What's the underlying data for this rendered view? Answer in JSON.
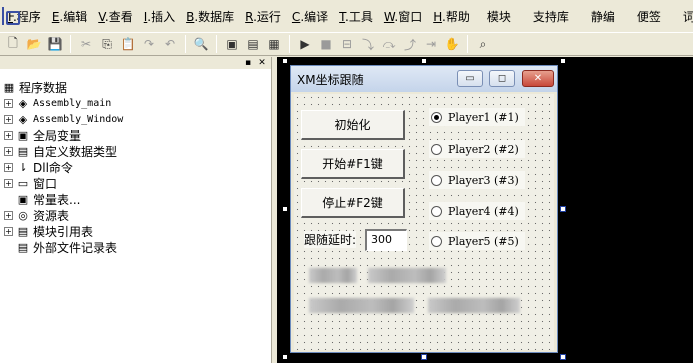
{
  "menubar": {
    "items": [
      {
        "key": "F",
        "label": ".程序"
      },
      {
        "key": "E",
        "label": ".编辑"
      },
      {
        "key": "V",
        "label": ".查看"
      },
      {
        "key": "I",
        "label": ".插入"
      },
      {
        "key": "B",
        "label": ".数据库"
      },
      {
        "key": "R",
        "label": ".运行"
      },
      {
        "key": "C",
        "label": ".编译"
      },
      {
        "key": "T",
        "label": ".工具"
      },
      {
        "key": "W",
        "label": ".窗口"
      },
      {
        "key": "H",
        "label": ".帮助"
      }
    ],
    "extra": [
      "模块",
      "支持库",
      "静编",
      "便签",
      "词表"
    ]
  },
  "tree": {
    "root": "程序数据",
    "items": [
      {
        "label": "Assembly_main",
        "mono": true,
        "expand": "+"
      },
      {
        "label": "Assembly_Window",
        "mono": true,
        "expand": "+"
      },
      {
        "label": "全局变量",
        "expand": "+"
      },
      {
        "label": "自定义数据类型",
        "expand": "+"
      },
      {
        "label": "Dll命令",
        "expand": "+"
      },
      {
        "label": "窗口",
        "expand": "+"
      },
      {
        "label": "常量表...",
        "expand": ""
      },
      {
        "label": "资源表",
        "expand": "+"
      },
      {
        "label": "模块引用表",
        "expand": "+"
      },
      {
        "label": "外部文件记录表",
        "expand": ""
      }
    ]
  },
  "window": {
    "title": "XM坐标跟随",
    "buttons": {
      "init": "初始化",
      "start": "开始#F1键",
      "stop": "停止#F2键"
    },
    "delay_label": "跟随延时:",
    "delay_value": "300",
    "players": [
      {
        "label": "Player1 (#1)",
        "selected": true
      },
      {
        "label": "Player2 (#2)",
        "selected": false
      },
      {
        "label": "Player3 (#3)",
        "selected": false
      },
      {
        "label": "Player4 (#4)",
        "selected": false
      },
      {
        "label": "Player5 (#5)",
        "selected": false
      }
    ]
  }
}
